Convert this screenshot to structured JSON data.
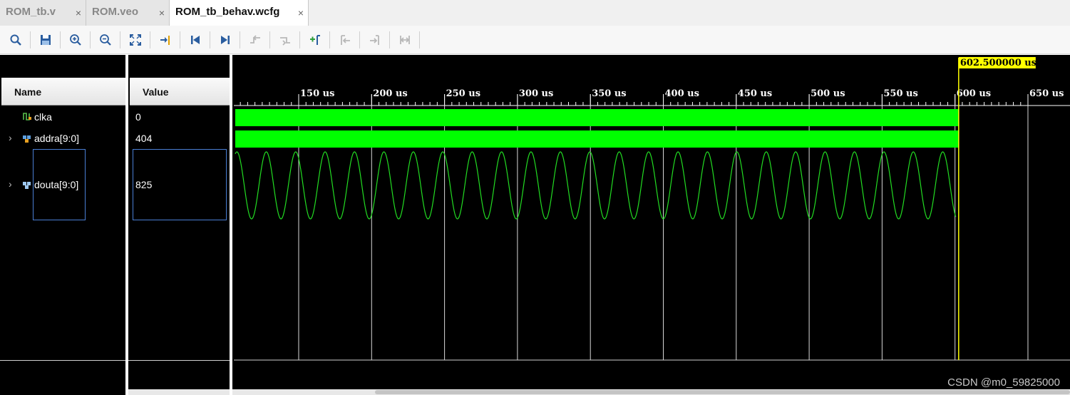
{
  "tabs": [
    {
      "label": "ROM_tb.v",
      "close": "×",
      "active": false
    },
    {
      "label": "ROM.veo",
      "close": "×",
      "active": false
    },
    {
      "label": "ROM_tb_behav.wcfg",
      "close": "×",
      "active": true
    }
  ],
  "toolbar": {
    "buttons": [
      "search-icon",
      "save-icon",
      "zoom-in-icon",
      "zoom-out-icon",
      "zoom-fit-icon",
      "go-to-cursor-icon",
      "go-to-time-0-icon",
      "go-to-last-time-icon",
      "previous-transition-icon",
      "next-transition-icon",
      "add-marker-icon",
      "previous-marker-icon",
      "next-marker-icon",
      "swap-cursors-icon"
    ]
  },
  "columns": {
    "name": "Name",
    "value": "Value"
  },
  "signals": [
    {
      "name": "clka",
      "value": "0",
      "icon": "clock-signal-icon",
      "expandable": false
    },
    {
      "name": "addra[9:0]",
      "value": "404",
      "icon": "bus-signal-icon",
      "expandable": true
    },
    {
      "name": "douta[9:0]",
      "value": "825",
      "icon": "bus-signal-icon",
      "expandable": true
    }
  ],
  "cursor": {
    "time_label": "602.500000 us",
    "time_us": 602.5
  },
  "timeline": {
    "unit": "us",
    "ticks": [
      "150 us",
      "200 us",
      "250 us",
      "300 us",
      "350 us",
      "400 us",
      "450 us",
      "500 us",
      "550 us",
      "600 us",
      "650 us"
    ],
    "tick_values": [
      150,
      200,
      250,
      300,
      350,
      400,
      450,
      500,
      550,
      600,
      650
    ]
  },
  "waveform": {
    "douta_style": "analog",
    "douta_cycles_visible": 24.5,
    "colors": {
      "trace": "#00ff00",
      "analog": "#22dd22",
      "cursor": "#ffff00",
      "background": "#000000"
    }
  },
  "watermark": "CSDN @m0_59825000"
}
